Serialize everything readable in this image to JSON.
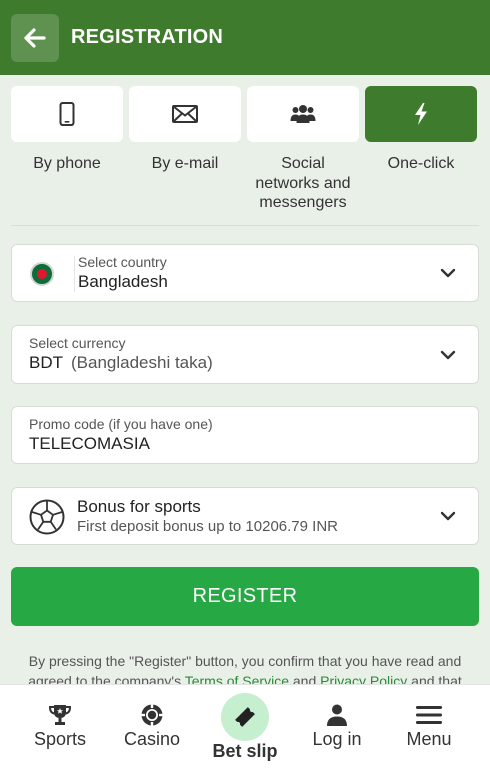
{
  "header": {
    "title": "REGISTRATION"
  },
  "methods": [
    {
      "label": "By phone",
      "icon": "phone-icon",
      "active": false
    },
    {
      "label": "By e-mail",
      "icon": "envelope-icon",
      "active": false
    },
    {
      "label": "Social networks and messengers",
      "icon": "users-icon",
      "active": false
    },
    {
      "label": "One-click",
      "icon": "lightning-icon",
      "active": true
    }
  ],
  "country": {
    "label": "Select country",
    "value": "Bangladesh"
  },
  "currency": {
    "label": "Select currency",
    "code": "BDT",
    "name": "(Bangladeshi taka)"
  },
  "promo": {
    "label": "Promo code (if you have one)",
    "value": "TELECOMASIA"
  },
  "bonus": {
    "title": "Bonus for sports",
    "subtitle": "First deposit bonus up to 10206.79 INR"
  },
  "register_button": "REGISTER",
  "disclaimer": {
    "line1": "By pressing the \"Register\" button, you confirm that you have read and",
    "line2_prefix": "agreed to the company's ",
    "terms_link": "Terms of Service",
    "and": " and ",
    "privacy_link": "Privacy Policy",
    "line2_suffix": " and that"
  },
  "nav": {
    "sports": "Sports",
    "casino": "Casino",
    "betslip": "Bet slip",
    "login": "Log in",
    "menu": "Menu"
  },
  "colors": {
    "brand_green": "#3f7b2c",
    "register_green": "#26a844",
    "background": "#e9f0e8"
  }
}
